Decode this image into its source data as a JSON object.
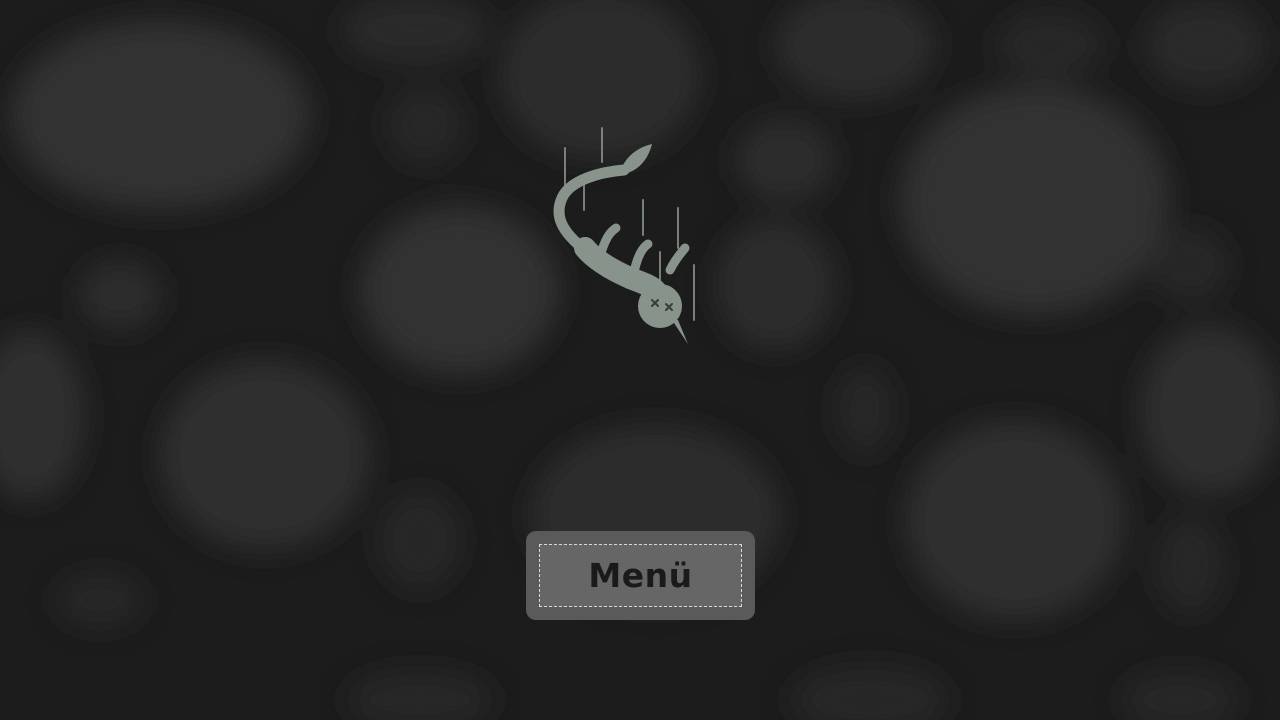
{
  "menu_button": {
    "label": "Menü"
  },
  "character": {
    "icon": "falling-cat-icon",
    "state": "knocked-out"
  },
  "colors": {
    "background": "#1c1c1c",
    "blob": "#3a3a3a",
    "character": "#8a958d",
    "button_outer": "#5a5a5a",
    "button_inner": "#666666",
    "button_text": "#1a1a1a"
  }
}
